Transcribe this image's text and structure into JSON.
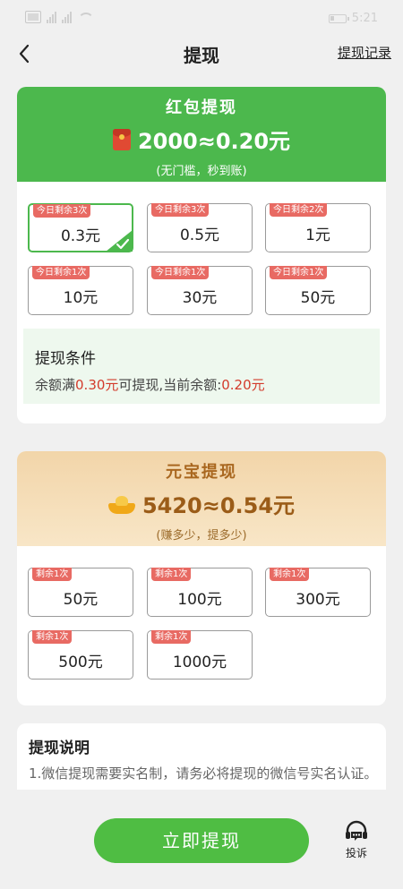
{
  "status_bar": {
    "time": "5:21"
  },
  "header": {
    "title": "提现",
    "record_link": "提现记录"
  },
  "red_packet": {
    "title": "红包提现",
    "amount": "2000≈0.20元",
    "subtitle": "(无门槛，秒到账)",
    "options": [
      {
        "tag": "今日剩余3次",
        "value": "0.3元",
        "selected": true
      },
      {
        "tag": "今日剩余3次",
        "value": "0.5元"
      },
      {
        "tag": "今日剩余2次",
        "value": "1元"
      },
      {
        "tag": "今日剩余1次",
        "value": "10元"
      },
      {
        "tag": "今日剩余1次",
        "value": "30元"
      },
      {
        "tag": "今日剩余1次",
        "value": "50元"
      }
    ],
    "condition": {
      "title": "提现条件",
      "prefix": "余额满",
      "required": "0.30元",
      "middle": "可提现,当前余额:",
      "current": "0.20元"
    }
  },
  "ingot": {
    "title": "元宝提现",
    "amount": "5420≈0.54元",
    "subtitle": "(赚多少，提多少)",
    "options": [
      {
        "tag": "剩余1次",
        "value": "50元"
      },
      {
        "tag": "剩余1次",
        "value": "100元"
      },
      {
        "tag": "剩余1次",
        "value": "300元"
      },
      {
        "tag": "剩余1次",
        "value": "500元"
      },
      {
        "tag": "剩余1次",
        "value": "1000元"
      }
    ]
  },
  "instructions": {
    "title": "提现说明",
    "text": "1.微信提现需要实名制，请务必将提现的微信号实名认证。"
  },
  "bottom": {
    "button": "立即提现",
    "complain": "投诉"
  },
  "colors": {
    "green": "#4cb84d",
    "gold_text": "#9b5c18",
    "tag_red": "#e86a63",
    "highlight_red": "#d33b2c"
  }
}
